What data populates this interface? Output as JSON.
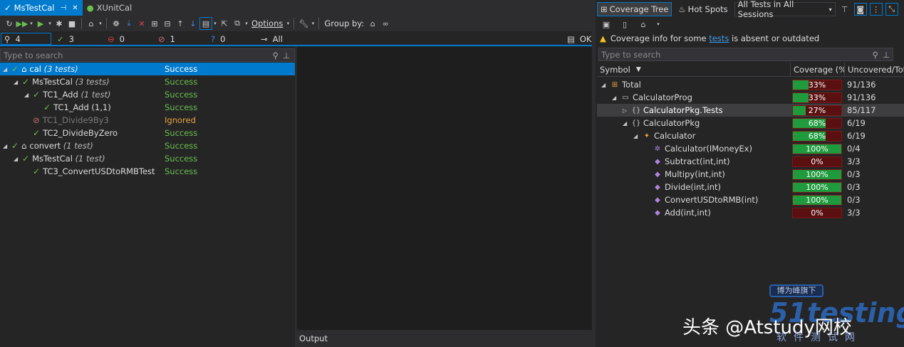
{
  "left_tabs": [
    {
      "label": "MsTestCal",
      "active": true
    },
    {
      "label": "XUnitCal",
      "active": false
    }
  ],
  "toolbar": {
    "options_label": "Options",
    "group_by_label": "Group by:"
  },
  "stats": {
    "total": "4",
    "passed": "3",
    "failed": "0",
    "ignored": "1",
    "inconclusive": "0",
    "all_label": "All",
    "ok_label": "OK"
  },
  "left_search": {
    "placeholder": "Type to search"
  },
  "tests": [
    {
      "name": "cal",
      "count": "(3 tests)",
      "status": "Success",
      "level": 0,
      "selected": true,
      "state": "pass",
      "tag": true
    },
    {
      "name": "MsTestCal",
      "count": "(3 tests)",
      "status": "Success",
      "level": 1,
      "state": "pass"
    },
    {
      "name": "TC1_Add",
      "count": "(1 test)",
      "status": "Success",
      "level": 2,
      "state": "pass"
    },
    {
      "name": "TC1_Add (1,1)",
      "count": "",
      "status": "Success",
      "level": 3,
      "state": "pass"
    },
    {
      "name": "TC1_Divide9By3",
      "count": "",
      "status": "Ignored",
      "level": 2,
      "state": "ignored"
    },
    {
      "name": "TC2_DivideByZero",
      "count": "",
      "status": "Success",
      "level": 2,
      "state": "pass"
    },
    {
      "name": "convert",
      "count": "(1 test)",
      "status": "Success",
      "level": 0,
      "state": "pass",
      "tag": true
    },
    {
      "name": "MsTestCal",
      "count": "(1 test)",
      "status": "Success",
      "level": 1,
      "state": "pass"
    },
    {
      "name": "TC3_ConvertUSDtoRMBTest",
      "count": "",
      "status": "Success",
      "level": 2,
      "state": "pass"
    }
  ],
  "output_label": "Output",
  "coverage_toolbar": {
    "coverage_tree_label": "Coverage Tree",
    "hot_spots_label": "Hot Spots",
    "sessions_select": "All Tests in All Sessions"
  },
  "warning": {
    "prefix": "Coverage info for some ",
    "link": "tests",
    "suffix": " is absent or outdated"
  },
  "right_search": {
    "placeholder": "Type to search"
  },
  "columns": {
    "symbol": "Symbol",
    "coverage": "Coverage (%)",
    "uncovered": "Uncovered/Total"
  },
  "coverage_rows": [
    {
      "name": "Total",
      "coverage_pct": 33,
      "coverage_label": "33%",
      "uncovered": "91/136",
      "level": 0,
      "icon": "total-icon",
      "expander": "open"
    },
    {
      "name": "CalculatorProg",
      "coverage_pct": 33,
      "coverage_label": "33%",
      "uncovered": "91/136",
      "level": 1,
      "icon": "assembly-icon",
      "expander": "open"
    },
    {
      "name": "CalculatorPkg.Tests",
      "coverage_pct": 27,
      "coverage_label": "27%",
      "uncovered": "85/117",
      "level": 2,
      "icon": "namespace-icon",
      "expander": "closed",
      "selected": true
    },
    {
      "name": "CalculatorPkg",
      "coverage_pct": 68,
      "coverage_label": "68%",
      "uncovered": "6/19",
      "level": 2,
      "icon": "namespace-icon",
      "expander": "open"
    },
    {
      "name": "Calculator",
      "coverage_pct": 68,
      "coverage_label": "68%",
      "uncovered": "6/19",
      "level": 3,
      "icon": "class-icon",
      "expander": "open"
    },
    {
      "name": "Calculator(IMoneyEx)",
      "coverage_pct": 100,
      "coverage_label": "100%",
      "uncovered": "0/4",
      "level": 4,
      "icon": "constructor-icon",
      "expander": "none"
    },
    {
      "name": "Subtract(int,int)",
      "coverage_pct": 0,
      "coverage_label": "0%",
      "uncovered": "3/3",
      "level": 4,
      "icon": "method-icon",
      "expander": "none"
    },
    {
      "name": "Multipy(int,int)",
      "coverage_pct": 100,
      "coverage_label": "100%",
      "uncovered": "0/3",
      "level": 4,
      "icon": "method-icon",
      "expander": "none"
    },
    {
      "name": "Divide(int,int)",
      "coverage_pct": 100,
      "coverage_label": "100%",
      "uncovered": "0/3",
      "level": 4,
      "icon": "method-icon",
      "expander": "none"
    },
    {
      "name": "ConvertUSDtoRMB(int)",
      "coverage_pct": 100,
      "coverage_label": "100%",
      "uncovered": "0/3",
      "level": 4,
      "icon": "method-icon",
      "expander": "none"
    },
    {
      "name": "Add(int,int)",
      "coverage_pct": 0,
      "coverage_label": "0%",
      "uncovered": "3/3",
      "level": 4,
      "icon": "method-icon",
      "expander": "none"
    }
  ],
  "watermark": {
    "account": "头条 @Atstudy网校",
    "badge": "博为峰旗下",
    "brand": "51testing",
    "sub": "软件测试网"
  },
  "colors": {
    "accent": "#007acc",
    "pass": "#6abf4b",
    "ignored": "#e8a33b",
    "covered": "#1f9b3d",
    "uncovered": "#5a1010"
  }
}
